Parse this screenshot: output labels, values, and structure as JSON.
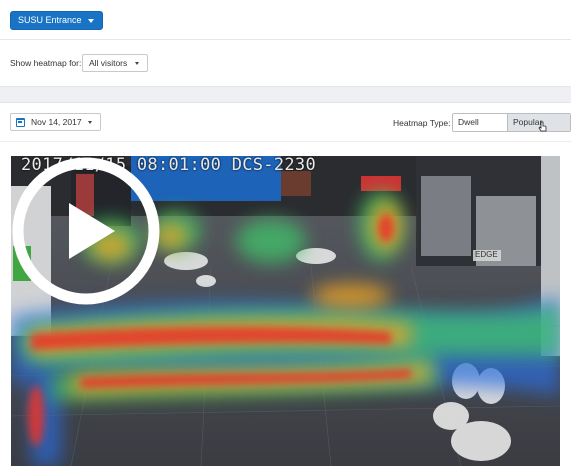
{
  "header": {
    "location_button": "SUSU Entrance"
  },
  "filters": {
    "show_heatmap_label": "Show heatmap for:",
    "visitor_select_value": "All visitors"
  },
  "toolbar": {
    "date_value": "Nov 14, 2017",
    "heatmap_type_label": "Heatmap Type:",
    "heatmap_types": [
      "Dwell areas",
      "Popular paths"
    ],
    "active_type": "Popular paths"
  },
  "video": {
    "timestamp": "2017/11/15 08:01:00 DCS-2230",
    "overlay_text": "EDGE"
  },
  "colors": {
    "primary": "#1a74c6",
    "heat_hot": "#e8342a",
    "heat_warm": "#f5a623",
    "heat_mid": "#3fc46a",
    "heat_cold": "#2a6de0"
  },
  "icons": {
    "location_caret": "chevron-down-icon",
    "calendar": "calendar-icon",
    "play": "play-icon",
    "cursor": "pointer-cursor-icon"
  }
}
